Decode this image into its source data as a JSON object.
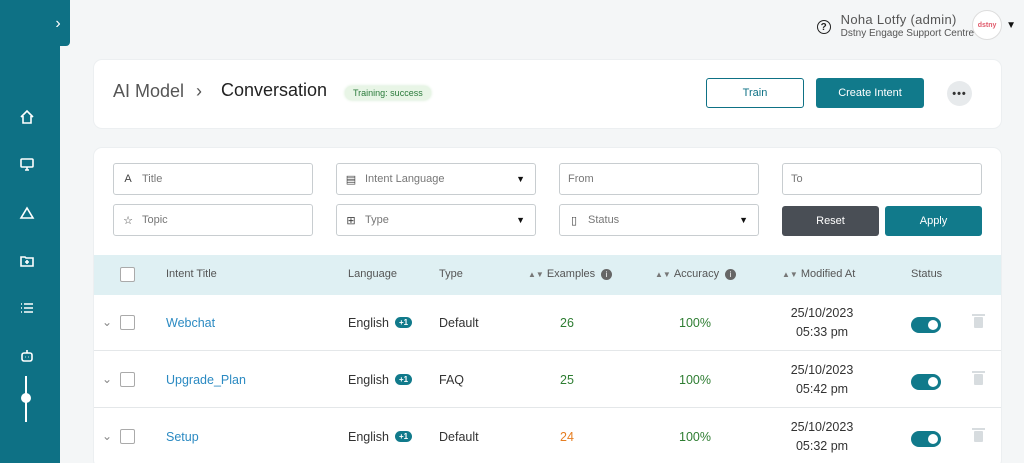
{
  "header": {
    "user_name": "Noha Lotfy (admin)",
    "org_name": "Dstny Engage Support Centre",
    "avatar_text": "dstny"
  },
  "breadcrumb": {
    "root": "AI Model",
    "current": "Conversation"
  },
  "training_status": "Training: success",
  "actions": {
    "train": "Train",
    "create_intent": "Create Intent",
    "more": "•••"
  },
  "filters": {
    "title_placeholder": "Title",
    "topic_placeholder": "Topic",
    "language_placeholder": "Intent Language",
    "type_placeholder": "Type",
    "from_placeholder": "From",
    "to_placeholder": "To",
    "status_placeholder": "Status",
    "reset": "Reset",
    "apply": "Apply"
  },
  "table": {
    "columns": {
      "title": "Intent Title",
      "language": "Language",
      "type": "Type",
      "examples": "Examples",
      "accuracy": "Accuracy",
      "modified": "Modified At",
      "status": "Status"
    },
    "rows": [
      {
        "title": "Webchat",
        "language": "English",
        "extra_langs": "+1",
        "type": "Default",
        "examples": "26",
        "examples_color": "#2e7d32",
        "accuracy": "100%",
        "date": "25/10/2023",
        "time": "05:33 pm",
        "enabled": true
      },
      {
        "title": "Upgrade_Plan",
        "language": "English",
        "extra_langs": "+1",
        "type": "FAQ",
        "examples": "25",
        "examples_color": "#2e7d32",
        "accuracy": "100%",
        "date": "25/10/2023",
        "time": "05:42 pm",
        "enabled": true
      },
      {
        "title": "Setup",
        "language": "English",
        "extra_langs": "+1",
        "type": "Default",
        "examples": "24",
        "examples_color": "#e67e22",
        "accuracy": "100%",
        "date": "25/10/2023",
        "time": "05:32 pm",
        "enabled": true
      }
    ]
  },
  "colors": {
    "primary": "#117a8b",
    "sidebar": "#0e7185",
    "accuracy": "#2e7d32"
  }
}
